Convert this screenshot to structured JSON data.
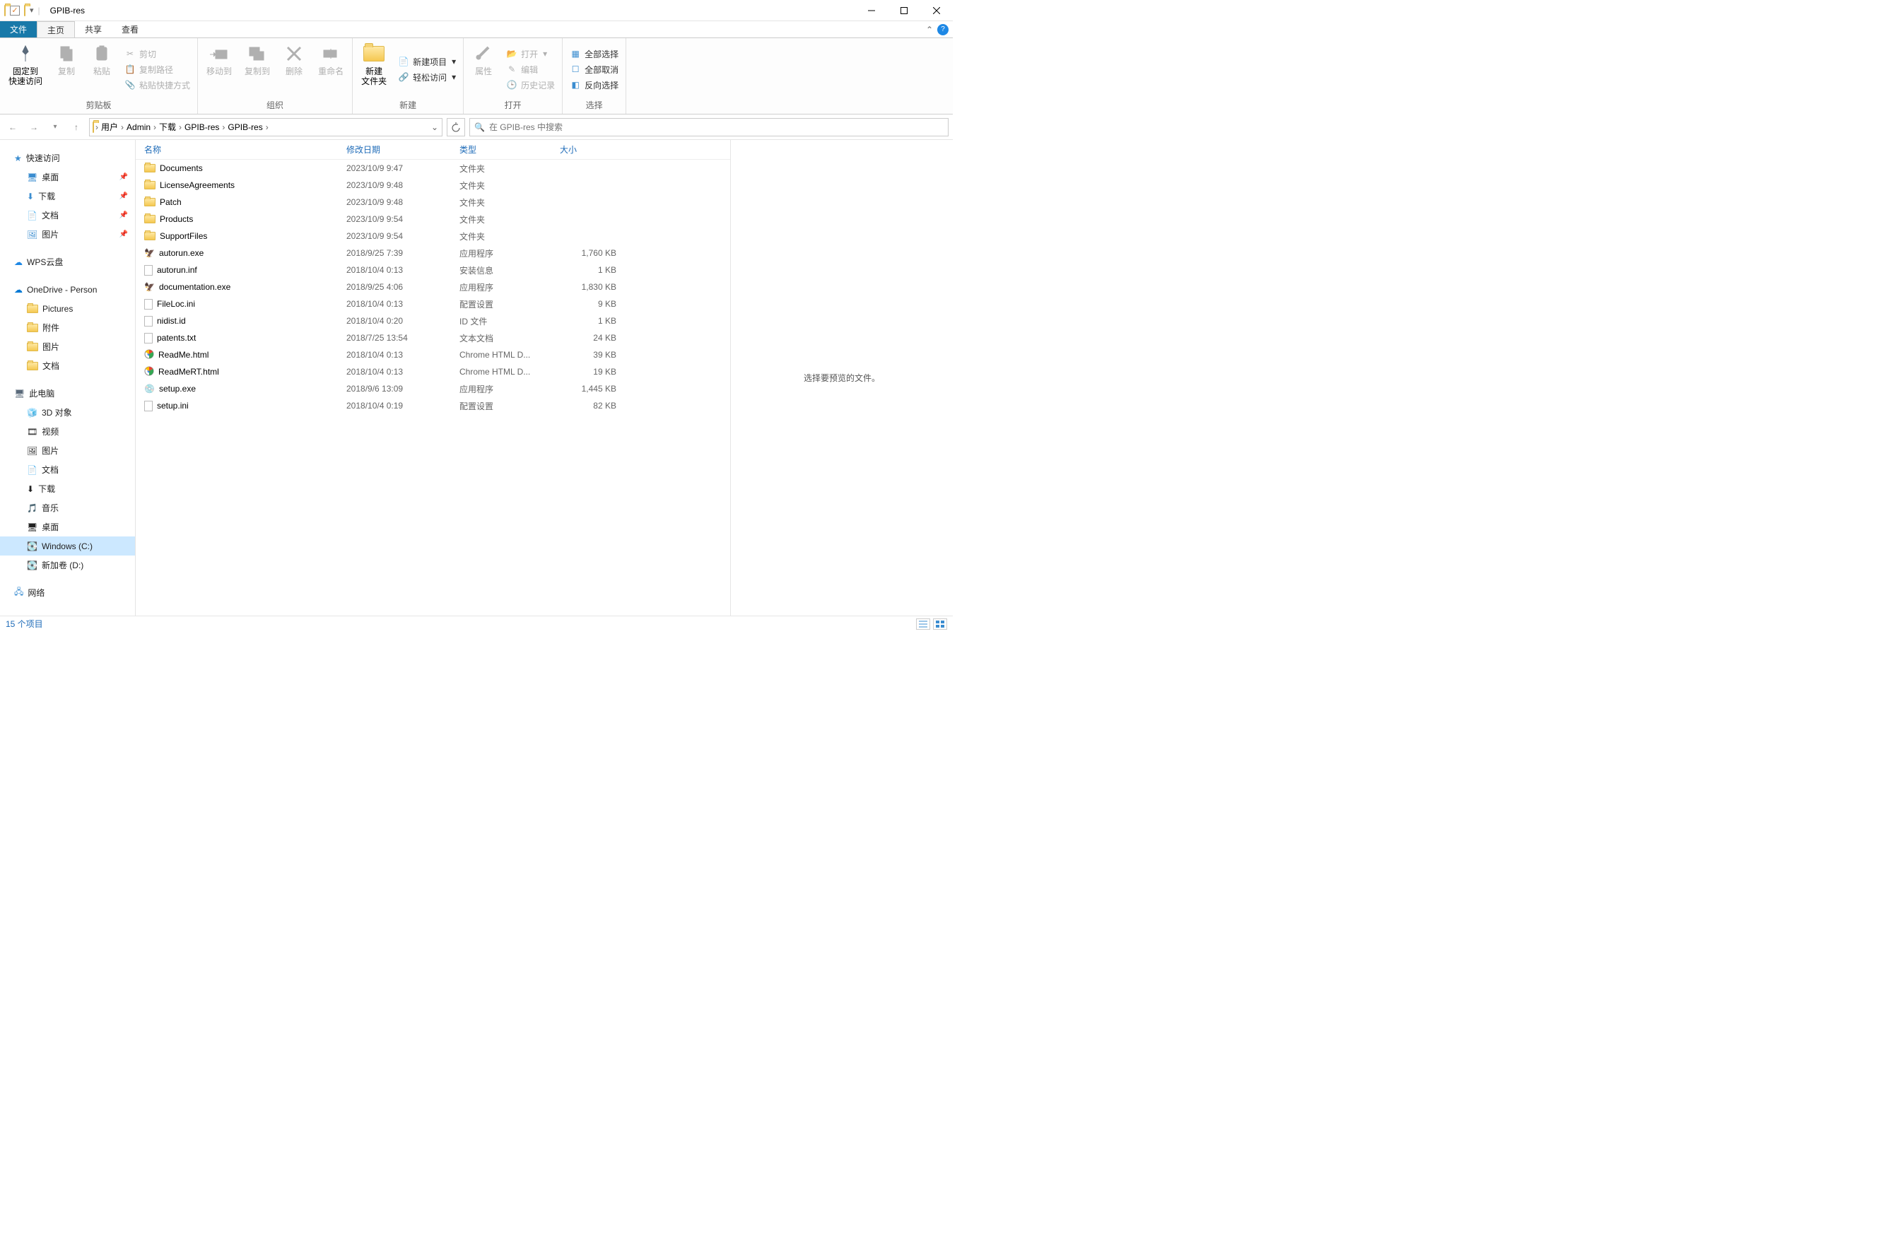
{
  "window": {
    "title": "GPIB-res"
  },
  "tabs": {
    "file": "文件",
    "home": "主页",
    "share": "共享",
    "view": "查看"
  },
  "ribbon": {
    "clipboard": {
      "label": "剪贴板",
      "pin": "固定到\n快速访问",
      "copy": "复制",
      "paste": "粘贴",
      "cut": "剪切",
      "copy_path": "复制路径",
      "paste_shortcut": "粘贴快捷方式"
    },
    "organize": {
      "label": "组织",
      "move_to": "移动到",
      "copy_to": "复制到",
      "delete": "删除",
      "rename": "重命名"
    },
    "new": {
      "label": "新建",
      "new_folder": "新建\n文件夹",
      "new_item": "新建项目",
      "easy_access": "轻松访问"
    },
    "open": {
      "label": "打开",
      "properties": "属性",
      "open": "打开",
      "edit": "编辑",
      "history": "历史记录"
    },
    "select": {
      "label": "选择",
      "select_all": "全部选择",
      "select_none": "全部取消",
      "invert": "反向选择"
    }
  },
  "breadcrumb": {
    "segments": [
      "用户",
      "Admin",
      "下载",
      "GPIB-res",
      "GPIB-res"
    ]
  },
  "search": {
    "placeholder": "在 GPIB-res 中搜索"
  },
  "nav": {
    "quick_access": "快速访问",
    "desktop": "桌面",
    "downloads": "下载",
    "documents": "文档",
    "pictures": "图片",
    "wps": "WPS云盘",
    "onedrive": "OneDrive - Person",
    "od_pictures": "Pictures",
    "od_attach": "附件",
    "od_pics_cn": "图片",
    "od_docs": "文档",
    "this_pc": "此电脑",
    "pc_3d": "3D 对象",
    "pc_video": "视频",
    "pc_pics": "图片",
    "pc_docs": "文档",
    "pc_dl": "下载",
    "pc_music": "音乐",
    "pc_desktop": "桌面",
    "pc_c": "Windows (C:)",
    "pc_d": "新加卷 (D:)",
    "network": "网络"
  },
  "columns": {
    "name": "名称",
    "date": "修改日期",
    "type": "类型",
    "size": "大小"
  },
  "files": [
    {
      "icon": "folder",
      "name": "Documents",
      "date": "2023/10/9 9:47",
      "type": "文件夹",
      "size": ""
    },
    {
      "icon": "folder",
      "name": "LicenseAgreements",
      "date": "2023/10/9 9:48",
      "type": "文件夹",
      "size": ""
    },
    {
      "icon": "folder",
      "name": "Patch",
      "date": "2023/10/9 9:48",
      "type": "文件夹",
      "size": ""
    },
    {
      "icon": "folder",
      "name": "Products",
      "date": "2023/10/9 9:54",
      "type": "文件夹",
      "size": ""
    },
    {
      "icon": "folder",
      "name": "SupportFiles",
      "date": "2023/10/9 9:54",
      "type": "文件夹",
      "size": ""
    },
    {
      "icon": "exe",
      "name": "autorun.exe",
      "date": "2018/9/25 7:39",
      "type": "应用程序",
      "size": "1,760 KB"
    },
    {
      "icon": "file",
      "name": "autorun.inf",
      "date": "2018/10/4 0:13",
      "type": "安装信息",
      "size": "1 KB"
    },
    {
      "icon": "exe",
      "name": "documentation.exe",
      "date": "2018/9/25 4:06",
      "type": "应用程序",
      "size": "1,830 KB"
    },
    {
      "icon": "file",
      "name": "FileLoc.ini",
      "date": "2018/10/4 0:13",
      "type": "配置设置",
      "size": "9 KB"
    },
    {
      "icon": "file",
      "name": "nidist.id",
      "date": "2018/10/4 0:20",
      "type": "ID 文件",
      "size": "1 KB"
    },
    {
      "icon": "file",
      "name": "patents.txt",
      "date": "2018/7/25 13:54",
      "type": "文本文档",
      "size": "24 KB"
    },
    {
      "icon": "chrome",
      "name": "ReadMe.html",
      "date": "2018/10/4 0:13",
      "type": "Chrome HTML D...",
      "size": "39 KB"
    },
    {
      "icon": "chrome",
      "name": "ReadMeRT.html",
      "date": "2018/10/4 0:13",
      "type": "Chrome HTML D...",
      "size": "19 KB"
    },
    {
      "icon": "setup",
      "name": "setup.exe",
      "date": "2018/9/6 13:09",
      "type": "应用程序",
      "size": "1,445 KB"
    },
    {
      "icon": "file",
      "name": "setup.ini",
      "date": "2018/10/4 0:19",
      "type": "配置设置",
      "size": "82 KB"
    }
  ],
  "preview": {
    "empty": "选择要预览的文件。"
  },
  "status": {
    "items": "15 个项目"
  }
}
